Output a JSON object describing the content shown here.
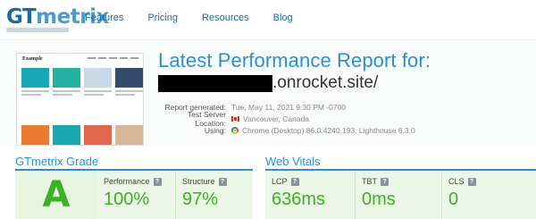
{
  "logo": {
    "part1": "GT",
    "part2": "metrix"
  },
  "nav": [
    "Features",
    "Pricing",
    "Resources",
    "Blog"
  ],
  "thumbnail": {
    "site_title": "Example"
  },
  "report": {
    "title": "Latest Performance Report for:",
    "url_suffix": ".onrocket.site/",
    "meta": [
      {
        "label": "Report generated:",
        "value": "Tue, May 11, 2021 9:30 PM -0700",
        "icon": ""
      },
      {
        "label": "Test Server Location:",
        "value": "Vancouver, Canada",
        "icon": "canada-flag-icon"
      },
      {
        "label": "Using:",
        "value": "Chrome (Desktop) 86.0.4240.193, Lighthouse 6.3.0",
        "icon": "chrome-icon"
      }
    ]
  },
  "grade": {
    "section_title": "GTmetrix Grade",
    "letter": "A",
    "metrics": [
      {
        "label": "Performance",
        "value": "100%"
      },
      {
        "label": "Structure",
        "value": "97%"
      }
    ]
  },
  "vitals": {
    "section_title": "Web Vitals",
    "metrics": [
      {
        "label": "LCP",
        "value": "636ms"
      },
      {
        "label": "TBT",
        "value": "0ms"
      },
      {
        "label": "CLS",
        "value": "0"
      }
    ]
  },
  "help_icon_glyph": "?",
  "colors": {
    "brand_blue": "#2d8fcf",
    "grade_green": "#3db026",
    "grade_bg": "#e7f5e1"
  }
}
